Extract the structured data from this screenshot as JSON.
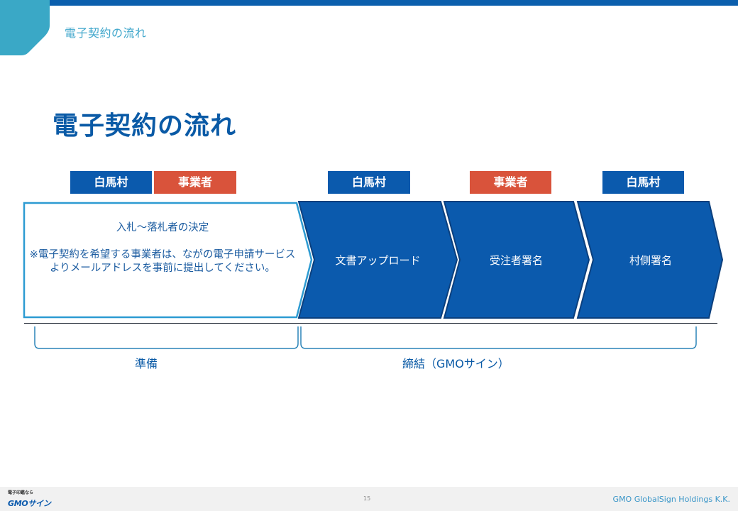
{
  "header": {
    "section_title": "電子契約の流れ"
  },
  "main": {
    "title": "電子契約の流れ",
    "badges": [
      {
        "label": "白馬村",
        "role": "village"
      },
      {
        "label": "事業者",
        "role": "business"
      },
      {
        "label": "白馬村",
        "role": "village"
      },
      {
        "label": "事業者",
        "role": "business"
      },
      {
        "label": "白馬村",
        "role": "village"
      }
    ],
    "steps": [
      {
        "title": "入札～落札者の決定",
        "note": "※電子契約を希望する事業者は、ながの電子申請サービスよりメールアドレスを事前に提出してください。"
      },
      {
        "title": "文書アップロード"
      },
      {
        "title": "受注者署名"
      },
      {
        "title": "村側署名"
      }
    ],
    "phases": [
      {
        "label": "準備"
      },
      {
        "label": "締結（GMOサイン）"
      }
    ]
  },
  "footer": {
    "logo_tagline": "電子印鑑なら",
    "logo_text": "GMOサイン",
    "page_number": "15",
    "company": "GMO GlobalSign Holdings K.K."
  },
  "colors": {
    "brand_blue": "#0b5aad",
    "accent_red": "#d9533b",
    "light_blue": "#3ea6cb"
  }
}
